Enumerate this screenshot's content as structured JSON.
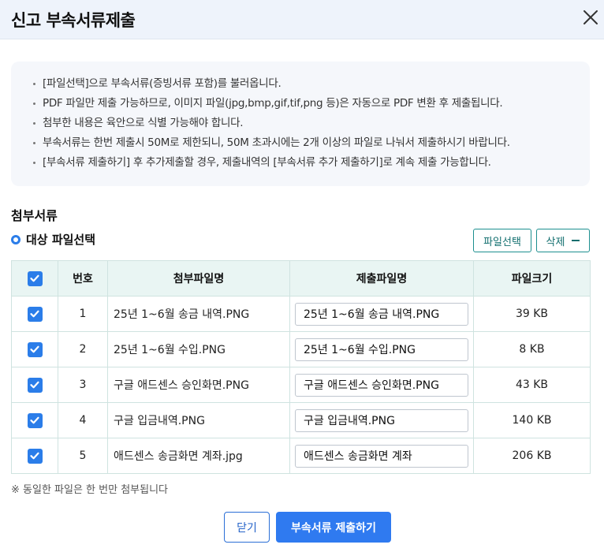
{
  "dialog": {
    "title": "신고 부속서류제출",
    "close_icon": "close-icon"
  },
  "notice": [
    "[파일선택]으로 부속서류(증빙서류 포함)를 불러옵니다.",
    "PDF 파일만 제출 가능하므로, 이미지 파일(jpg,bmp,gif,tif,png 등)은 자동으로 PDF 변환 후 제출됩니다.",
    "첨부한 내용은 육안으로 식별 가능해야 합니다.",
    "부속서류는 한번 제출시 50M로 제한되니, 50M 초과시에는 2개 이상의 파일로 나눠서 제출하시기 바랍니다.",
    "[부속서류 제출하기] 후 추가제출할 경우, 제출내역의 [부속서류 추가 제출하기]로 계속 제출 가능합니다."
  ],
  "attach": {
    "section_title": "첨부서류",
    "subtitle": "대상 파일선택",
    "select_button": "파일선택",
    "delete_button": "삭제"
  },
  "table": {
    "headers": {
      "no": "번호",
      "filename": "첨부파일명",
      "submit_name": "제출파일명",
      "size": "파일크기"
    },
    "rows": [
      {
        "checked": true,
        "no": "1",
        "filename": "25년 1~6월 송금 내역.PNG",
        "submit_name": "25년 1~6월 송금 내역.PNG",
        "size": "39 KB"
      },
      {
        "checked": true,
        "no": "2",
        "filename": "25년 1~6월 수입.PNG",
        "submit_name": "25년 1~6월 수입.PNG",
        "size": "8 KB"
      },
      {
        "checked": true,
        "no": "3",
        "filename": "구글 애드센스 승인화면.PNG",
        "submit_name": "구글 애드센스 승인화면.PNG",
        "size": "43 KB"
      },
      {
        "checked": true,
        "no": "4",
        "filename": "구글 입금내역.PNG",
        "submit_name": "구글 입금내역.PNG",
        "size": "140 KB"
      },
      {
        "checked": true,
        "no": "5",
        "filename": "애드센스 송금화면 계좌.jpg",
        "submit_name": "애드센스 송금화면 계좌",
        "size": "206 KB"
      }
    ]
  },
  "note": "※ 동일한 파일은 한 번만 첨부됩니다",
  "footer": {
    "close_button": "닫기",
    "submit_button": "부속서류 제출하기"
  },
  "colors": {
    "accent": "#2f7af0",
    "teal": "#1d8f8f",
    "header_bg": "#eef3fb"
  }
}
